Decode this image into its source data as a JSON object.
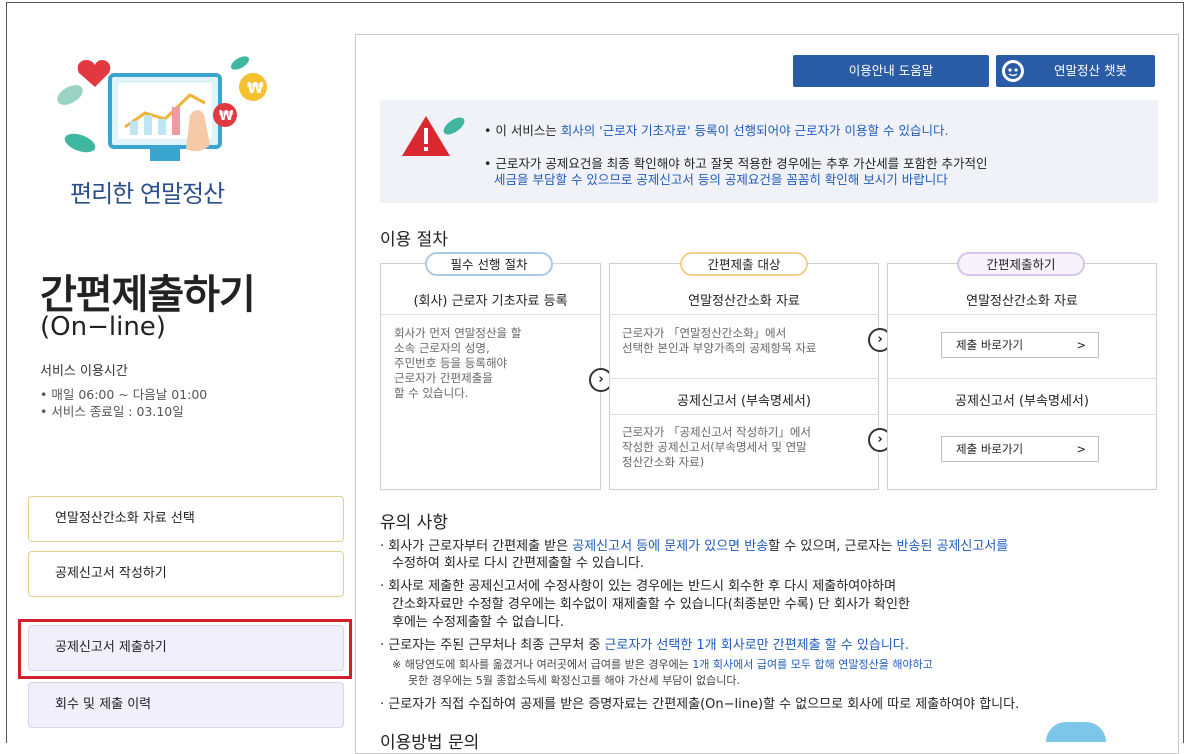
{
  "left": {
    "hero_title": "편리한 연말정산",
    "page_title": "간편제출하기",
    "page_subtitle": "(On−line)",
    "service_hours_label": "서비스 이용시간",
    "service_lines": [
      "• 매일 06:00 ~ 다음날 01:00",
      "• 서비스 종료일 : 03.10일"
    ],
    "menu": [
      {
        "label": "연말정산간소화 자료 선택"
      },
      {
        "label": "공제신고서 작성하기"
      },
      {
        "label": "공제신고서 제출하기"
      },
      {
        "label": "회수 및 제출 이력"
      }
    ]
  },
  "header_buttons": {
    "help": "이용안내 도움말",
    "chatbot": "연말정산 챗봇"
  },
  "notice": {
    "line1_a": "• 이 서비스는 ",
    "line1_b": "회사의 '근로자 기초자료' 등록이 선행되어야 근로자가 이용할 수 있습니다.",
    "line2_a": "• 근로자가 공제요건을 최종 확인해야 하고 잘못 적용한 경우에는 추후 가산세를 포함한 추가적인",
    "line2_b": "세금을 부담할 수 있으므로 공제신고서 등의 공제요건을 꼼꼼히 확인해 보시기 바랍니다"
  },
  "procedure": {
    "title": "이용 절차",
    "col1": {
      "pill": "필수 선행 절차",
      "head": "(회사) 근로자 기초자료 등록",
      "body": [
        "회사가 먼저 연말정산을 할",
        "소속 근로자의 성명,",
        "주민번호 등을 등록해야",
        "근로자가 간편제출을",
        "할 수 있습니다."
      ]
    },
    "col2": {
      "pill": "간편제출 대상",
      "head1": "연말정산간소화 자료",
      "body1": [
        "근로자가 「연말정산간소화」에서",
        "선택한 본인과 부양가족의 공제항목 자료"
      ],
      "head2": "공제신고서 (부속명세서)",
      "body2": [
        "근로자가 「공제신고서 작성하기」에서",
        "작성한 공제신고서(부속명세서 및 연말",
        "정산간소화 자료)"
      ]
    },
    "col3": {
      "pill": "간편제출하기",
      "head1": "연말정산간소화 자료",
      "btn1": "제출 바로가기",
      "head2": "공제신고서 (부속명세서)",
      "btn2": "제출 바로가기",
      "arrow": ">"
    }
  },
  "caution": {
    "title": "유의 사항",
    "items": [
      {
        "a": "· 회사가 근로자부터 간편제출 받은 ",
        "b": "공제신고서 등에 문제가 있으면 반송",
        "c": "할 수 있으며, 근로자는 ",
        "d": "반송된 공제신고서를"
      },
      {
        "e": "수정하여 회사로 다시 간편제출할 수 있습니다."
      }
    ],
    "item2_lines": [
      "· 회사로 제출한 공제신고서에 수정사항이 있는 경우에는 반드시 회수한 후 다시 제출하여야하며",
      "간소화자료만 수정할 경우에는 회수없이 재제출할 수 있습니다(최종분만 수록) 단 회사가 확인한",
      "후에는 수정제출할 수 없습니다."
    ],
    "item3_a": "· 근로자는 주된 근무처나 최종 근무처 중 ",
    "item3_b": "근로자가 선택한 1개 회사로만 간편제출 할 수 있습니다.",
    "item3_note1_a": "※ 해당연도에 회사를 옮겼거나 여러곳에서 급여를 받은 경우에는 ",
    "item3_note1_b": "1개 회사에서 급여를 모두 합해 연말정산을 해야하고",
    "item3_note2": "못한 경우에는 5월 종합소득세 확정신고를 해야 가산세 부담이 없습니다.",
    "item4": "· 근로자가 직접 수집하여 공제를 받은 증명자료는 간편제출(On−line)할 수 없으므로 회사에 따로 제출하여야 합니다.",
    "next_title": "이용방법 문의"
  }
}
